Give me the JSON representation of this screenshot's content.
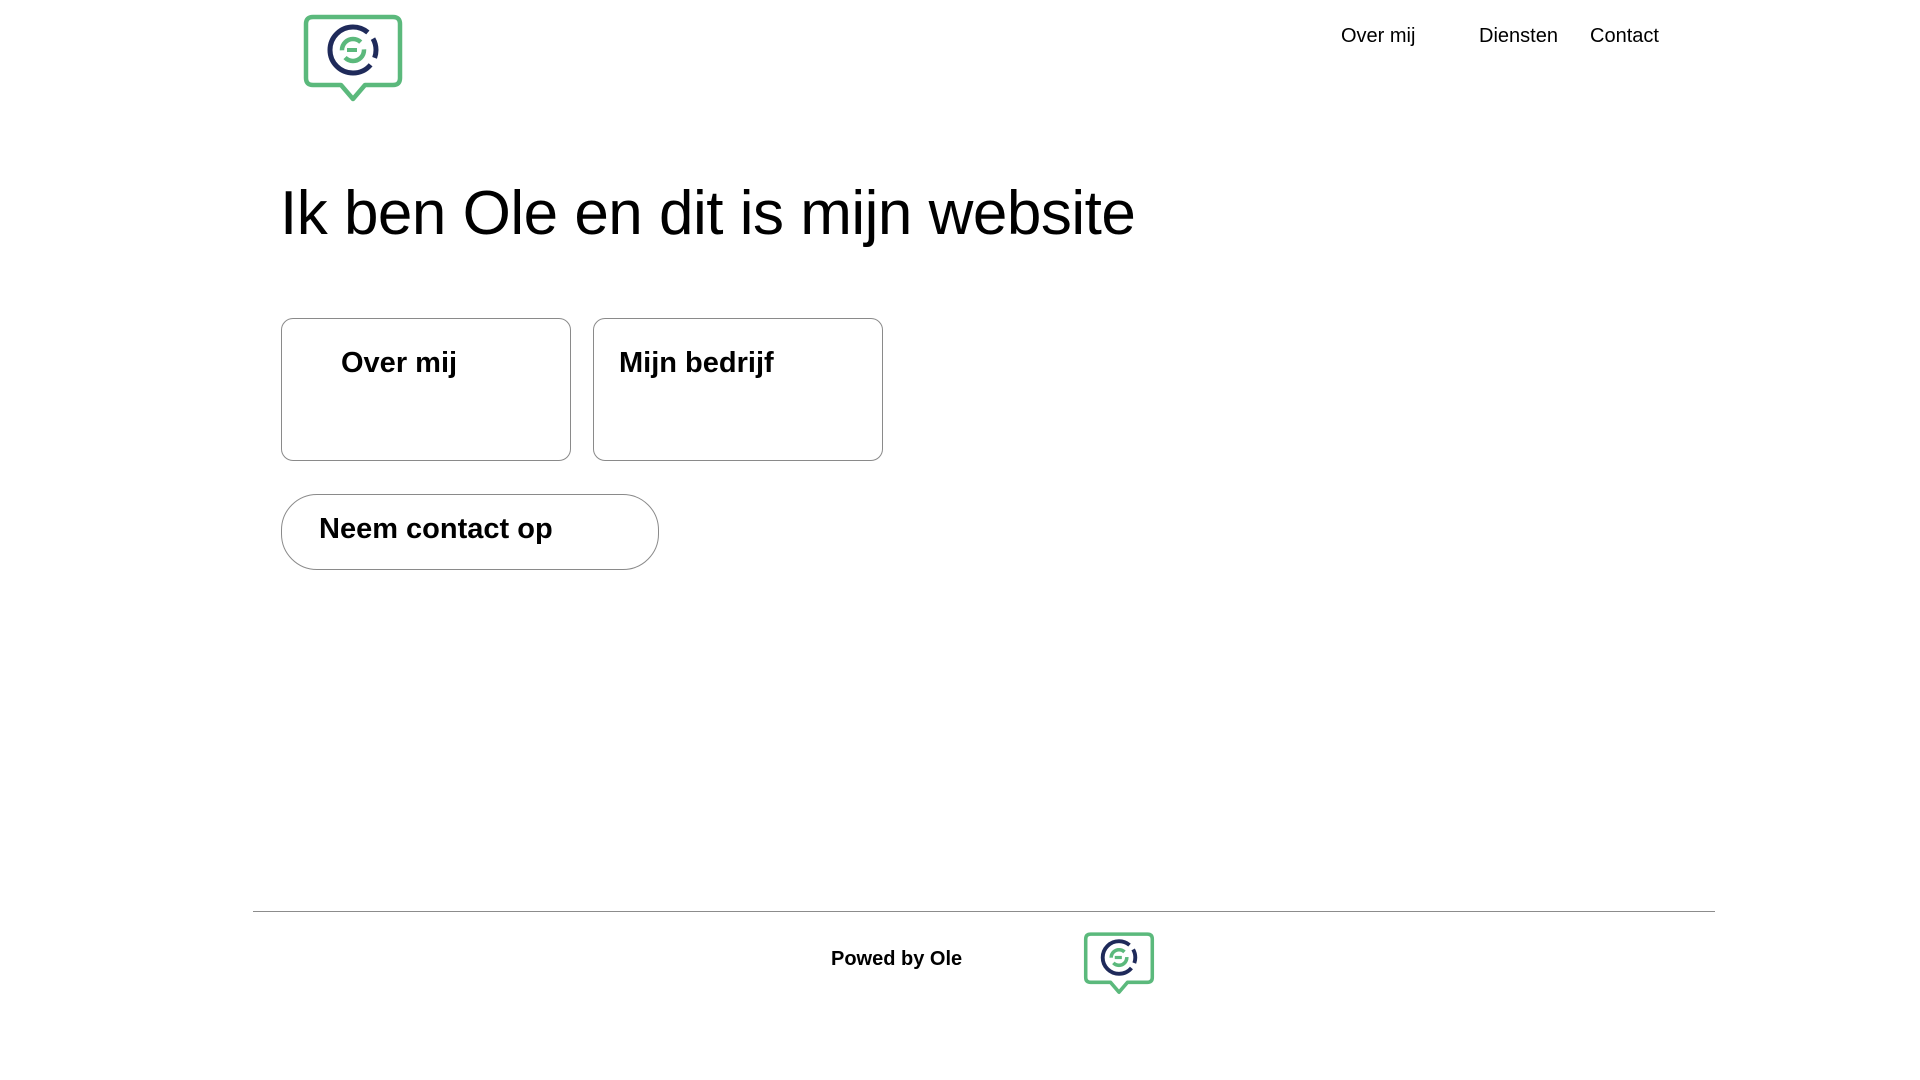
{
  "header": {
    "logo": {
      "icon": "chat-bubble-logo-icon",
      "colors": {
        "outline": "#5bb97c",
        "ring": "#1f2a5a",
        "inner": "#5bb97c"
      }
    },
    "nav": [
      {
        "label": "Over mij"
      },
      {
        "label": "Diensten"
      },
      {
        "label": "Contact"
      }
    ]
  },
  "hero": {
    "title": "Ik ben Ole en dit is mijn website"
  },
  "cards": [
    {
      "label": "Over mij"
    },
    {
      "label": "Mijn bedrijf"
    }
  ],
  "contact_button": {
    "label": "Neem contact op"
  },
  "footer": {
    "text": "Powed by Ole",
    "logo": {
      "icon": "chat-bubble-logo-icon"
    }
  }
}
